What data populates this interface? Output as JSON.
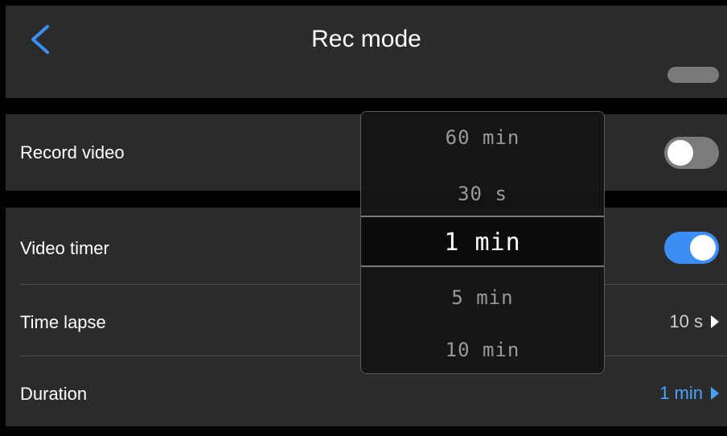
{
  "header": {
    "title": "Rec mode",
    "back_icon": "chevron-left-icon"
  },
  "rows": {
    "record_video": {
      "label": "Record video",
      "toggle_on": false
    },
    "video_timer": {
      "label": "Video timer",
      "toggle_on": true
    },
    "time_lapse": {
      "label": "Time lapse",
      "value": "10 s"
    },
    "duration": {
      "label": "Duration",
      "value": "1 min"
    }
  },
  "picker": {
    "options": [
      "60 min",
      "30 s",
      "1 min",
      "5 min",
      "10 min"
    ],
    "selected": "1 min"
  },
  "colors": {
    "accent": "#3b8ef6",
    "row_bg": "#2b2b2b",
    "toggle_off": "#7b7b7b"
  }
}
